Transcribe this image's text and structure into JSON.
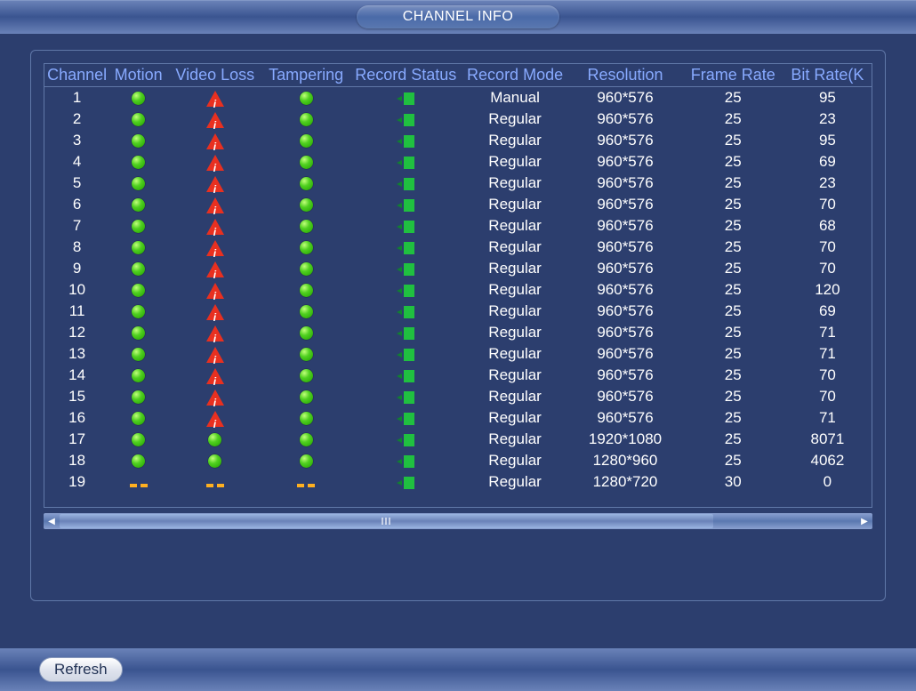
{
  "title": "CHANNEL INFO",
  "headers": [
    "Channel",
    "Motion",
    "Video Loss",
    "Tampering",
    "Record Status",
    "Record Mode",
    "Resolution",
    "Frame Rate",
    "Bit Rate(K"
  ],
  "rows": [
    {
      "ch": "1",
      "motion": "ok",
      "loss": "alert",
      "tamper": "ok",
      "rec": "on",
      "mode": "Manual",
      "res": "960*576",
      "fps": "25",
      "br": "95"
    },
    {
      "ch": "2",
      "motion": "ok",
      "loss": "alert",
      "tamper": "ok",
      "rec": "on",
      "mode": "Regular",
      "res": "960*576",
      "fps": "25",
      "br": "23"
    },
    {
      "ch": "3",
      "motion": "ok",
      "loss": "alert",
      "tamper": "ok",
      "rec": "on",
      "mode": "Regular",
      "res": "960*576",
      "fps": "25",
      "br": "95"
    },
    {
      "ch": "4",
      "motion": "ok",
      "loss": "alert",
      "tamper": "ok",
      "rec": "on",
      "mode": "Regular",
      "res": "960*576",
      "fps": "25",
      "br": "69"
    },
    {
      "ch": "5",
      "motion": "ok",
      "loss": "alert",
      "tamper": "ok",
      "rec": "on",
      "mode": "Regular",
      "res": "960*576",
      "fps": "25",
      "br": "23"
    },
    {
      "ch": "6",
      "motion": "ok",
      "loss": "alert",
      "tamper": "ok",
      "rec": "on",
      "mode": "Regular",
      "res": "960*576",
      "fps": "25",
      "br": "70"
    },
    {
      "ch": "7",
      "motion": "ok",
      "loss": "alert",
      "tamper": "ok",
      "rec": "on",
      "mode": "Regular",
      "res": "960*576",
      "fps": "25",
      "br": "68"
    },
    {
      "ch": "8",
      "motion": "ok",
      "loss": "alert",
      "tamper": "ok",
      "rec": "on",
      "mode": "Regular",
      "res": "960*576",
      "fps": "25",
      "br": "70"
    },
    {
      "ch": "9",
      "motion": "ok",
      "loss": "alert",
      "tamper": "ok",
      "rec": "on",
      "mode": "Regular",
      "res": "960*576",
      "fps": "25",
      "br": "70"
    },
    {
      "ch": "10",
      "motion": "ok",
      "loss": "alert",
      "tamper": "ok",
      "rec": "on",
      "mode": "Regular",
      "res": "960*576",
      "fps": "25",
      "br": "120"
    },
    {
      "ch": "11",
      "motion": "ok",
      "loss": "alert",
      "tamper": "ok",
      "rec": "on",
      "mode": "Regular",
      "res": "960*576",
      "fps": "25",
      "br": "69"
    },
    {
      "ch": "12",
      "motion": "ok",
      "loss": "alert",
      "tamper": "ok",
      "rec": "on",
      "mode": "Regular",
      "res": "960*576",
      "fps": "25",
      "br": "71"
    },
    {
      "ch": "13",
      "motion": "ok",
      "loss": "alert",
      "tamper": "ok",
      "rec": "on",
      "mode": "Regular",
      "res": "960*576",
      "fps": "25",
      "br": "71"
    },
    {
      "ch": "14",
      "motion": "ok",
      "loss": "alert",
      "tamper": "ok",
      "rec": "on",
      "mode": "Regular",
      "res": "960*576",
      "fps": "25",
      "br": "70"
    },
    {
      "ch": "15",
      "motion": "ok",
      "loss": "alert",
      "tamper": "ok",
      "rec": "on",
      "mode": "Regular",
      "res": "960*576",
      "fps": "25",
      "br": "70"
    },
    {
      "ch": "16",
      "motion": "ok",
      "loss": "alert",
      "tamper": "ok",
      "rec": "on",
      "mode": "Regular",
      "res": "960*576",
      "fps": "25",
      "br": "71"
    },
    {
      "ch": "17",
      "motion": "ok",
      "loss": "ok",
      "tamper": "ok",
      "rec": "on",
      "mode": "Regular",
      "res": "1920*1080",
      "fps": "25",
      "br": "8071"
    },
    {
      "ch": "18",
      "motion": "ok",
      "loss": "ok",
      "tamper": "ok",
      "rec": "on",
      "mode": "Regular",
      "res": "1280*960",
      "fps": "25",
      "br": "4062"
    },
    {
      "ch": "19",
      "motion": "dash",
      "loss": "dash",
      "tamper": "dash",
      "rec": "on",
      "mode": "Regular",
      "res": "1280*720",
      "fps": "30",
      "br": "0"
    }
  ],
  "buttons": {
    "refresh": "Refresh"
  }
}
